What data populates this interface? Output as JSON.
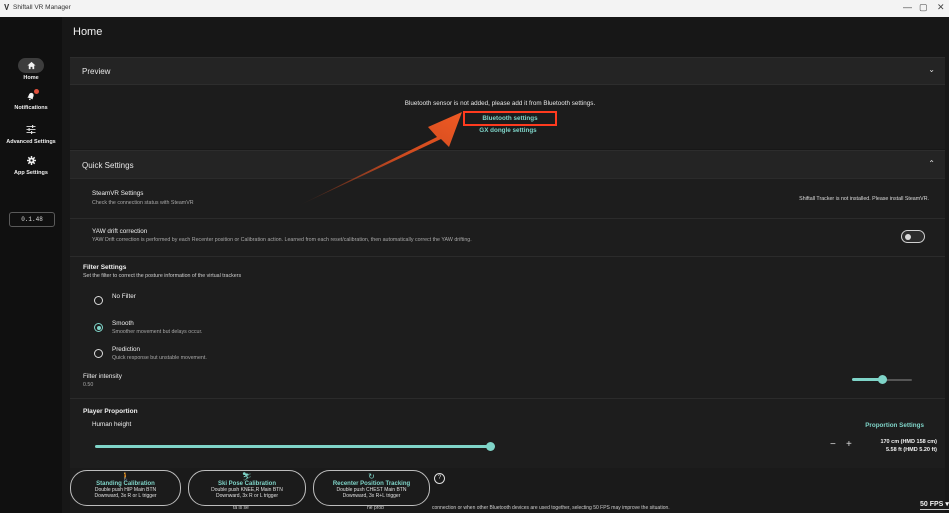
{
  "window": {
    "title": "Shiftall VR Manager",
    "minimize": "—",
    "maximize": "▢",
    "close": "✕"
  },
  "sidebar": {
    "items": [
      {
        "label": "Home",
        "icon": "home-icon"
      },
      {
        "label": "Notifications",
        "icon": "bell-icon"
      },
      {
        "label": "Advanced Settings",
        "icon": "sliders-icon"
      },
      {
        "label": "App Settings",
        "icon": "gear-icon"
      }
    ],
    "version": "0.1.48"
  },
  "page": {
    "title": "Home"
  },
  "preview": {
    "title": "Preview",
    "message": "Bluetooth sensor is not added, please add it from Bluetooth settings.",
    "bluetooth_link": "Bluetooth settings",
    "gx_link": "GX dongle settings"
  },
  "quick": {
    "title": "Quick Settings",
    "steamvr": {
      "title": "SteamVR Settings",
      "desc": "Check the connection status with SteamVR",
      "status": "Shiftall Tracker is not installed. Please install SteamVR."
    },
    "yaw": {
      "title": "YAW drift correction",
      "desc": "YAW Drift correction is performed by each Recenter position or Calibration action. Learned from each reset/calibration, then automatically correct the YAW drifting."
    },
    "filter": {
      "title": "Filter Settings",
      "desc": "Set the filter to correct the posture information of the virtual trackers",
      "options": [
        {
          "label": "No Filter",
          "desc": ""
        },
        {
          "label": "Smooth",
          "desc": "Smoother movement but delays occur."
        },
        {
          "label": "Prediction",
          "desc": "Quick response but unstable movement."
        }
      ],
      "selected": "Smooth",
      "intensity_label": "Filter intensity",
      "intensity_value": "0.50"
    },
    "proportion": {
      "title": "Player Proportion",
      "height_label": "Human height",
      "settings_link": "Proportion Settings",
      "minus": "−",
      "plus": "+",
      "height_cm": "170 cm (HMD 158 cm)",
      "height_ft": "5.58 ft (HMD 5.20 ft)",
      "slider_fraction": 0.5
    },
    "fps": {
      "value": "50 FPS",
      "note_a": "ta is se",
      "note_b": "ne prob",
      "note_c": "connection or when other Bluetooth devices are used together, selecting 50 FPS may improve the situation."
    }
  },
  "calibration": [
    {
      "icon": "person-icon",
      "glyph": "🚶",
      "title": "Standing Calibration",
      "line1": "Double push HIP Main BTN",
      "line2": "Downward, 3x R or L trigger"
    },
    {
      "icon": "ski-icon",
      "glyph": "⛷",
      "title": "Ski Pose Calibration",
      "line1": "Double push KNEE,R Main BTN",
      "line2": "Downward, 3x R or L trigger"
    },
    {
      "icon": "recenter-icon",
      "glyph": "↻",
      "title": "Recenter Position Tracking",
      "line1": "Double push CHEST Main BTN",
      "line2": "Downward, 3x R+L trigger"
    }
  ],
  "help_glyph": "?",
  "colors": {
    "accent": "#7fd4c8",
    "highlight": "#ff3b1f",
    "arrow": "#e8501e",
    "panel": "#222222"
  }
}
